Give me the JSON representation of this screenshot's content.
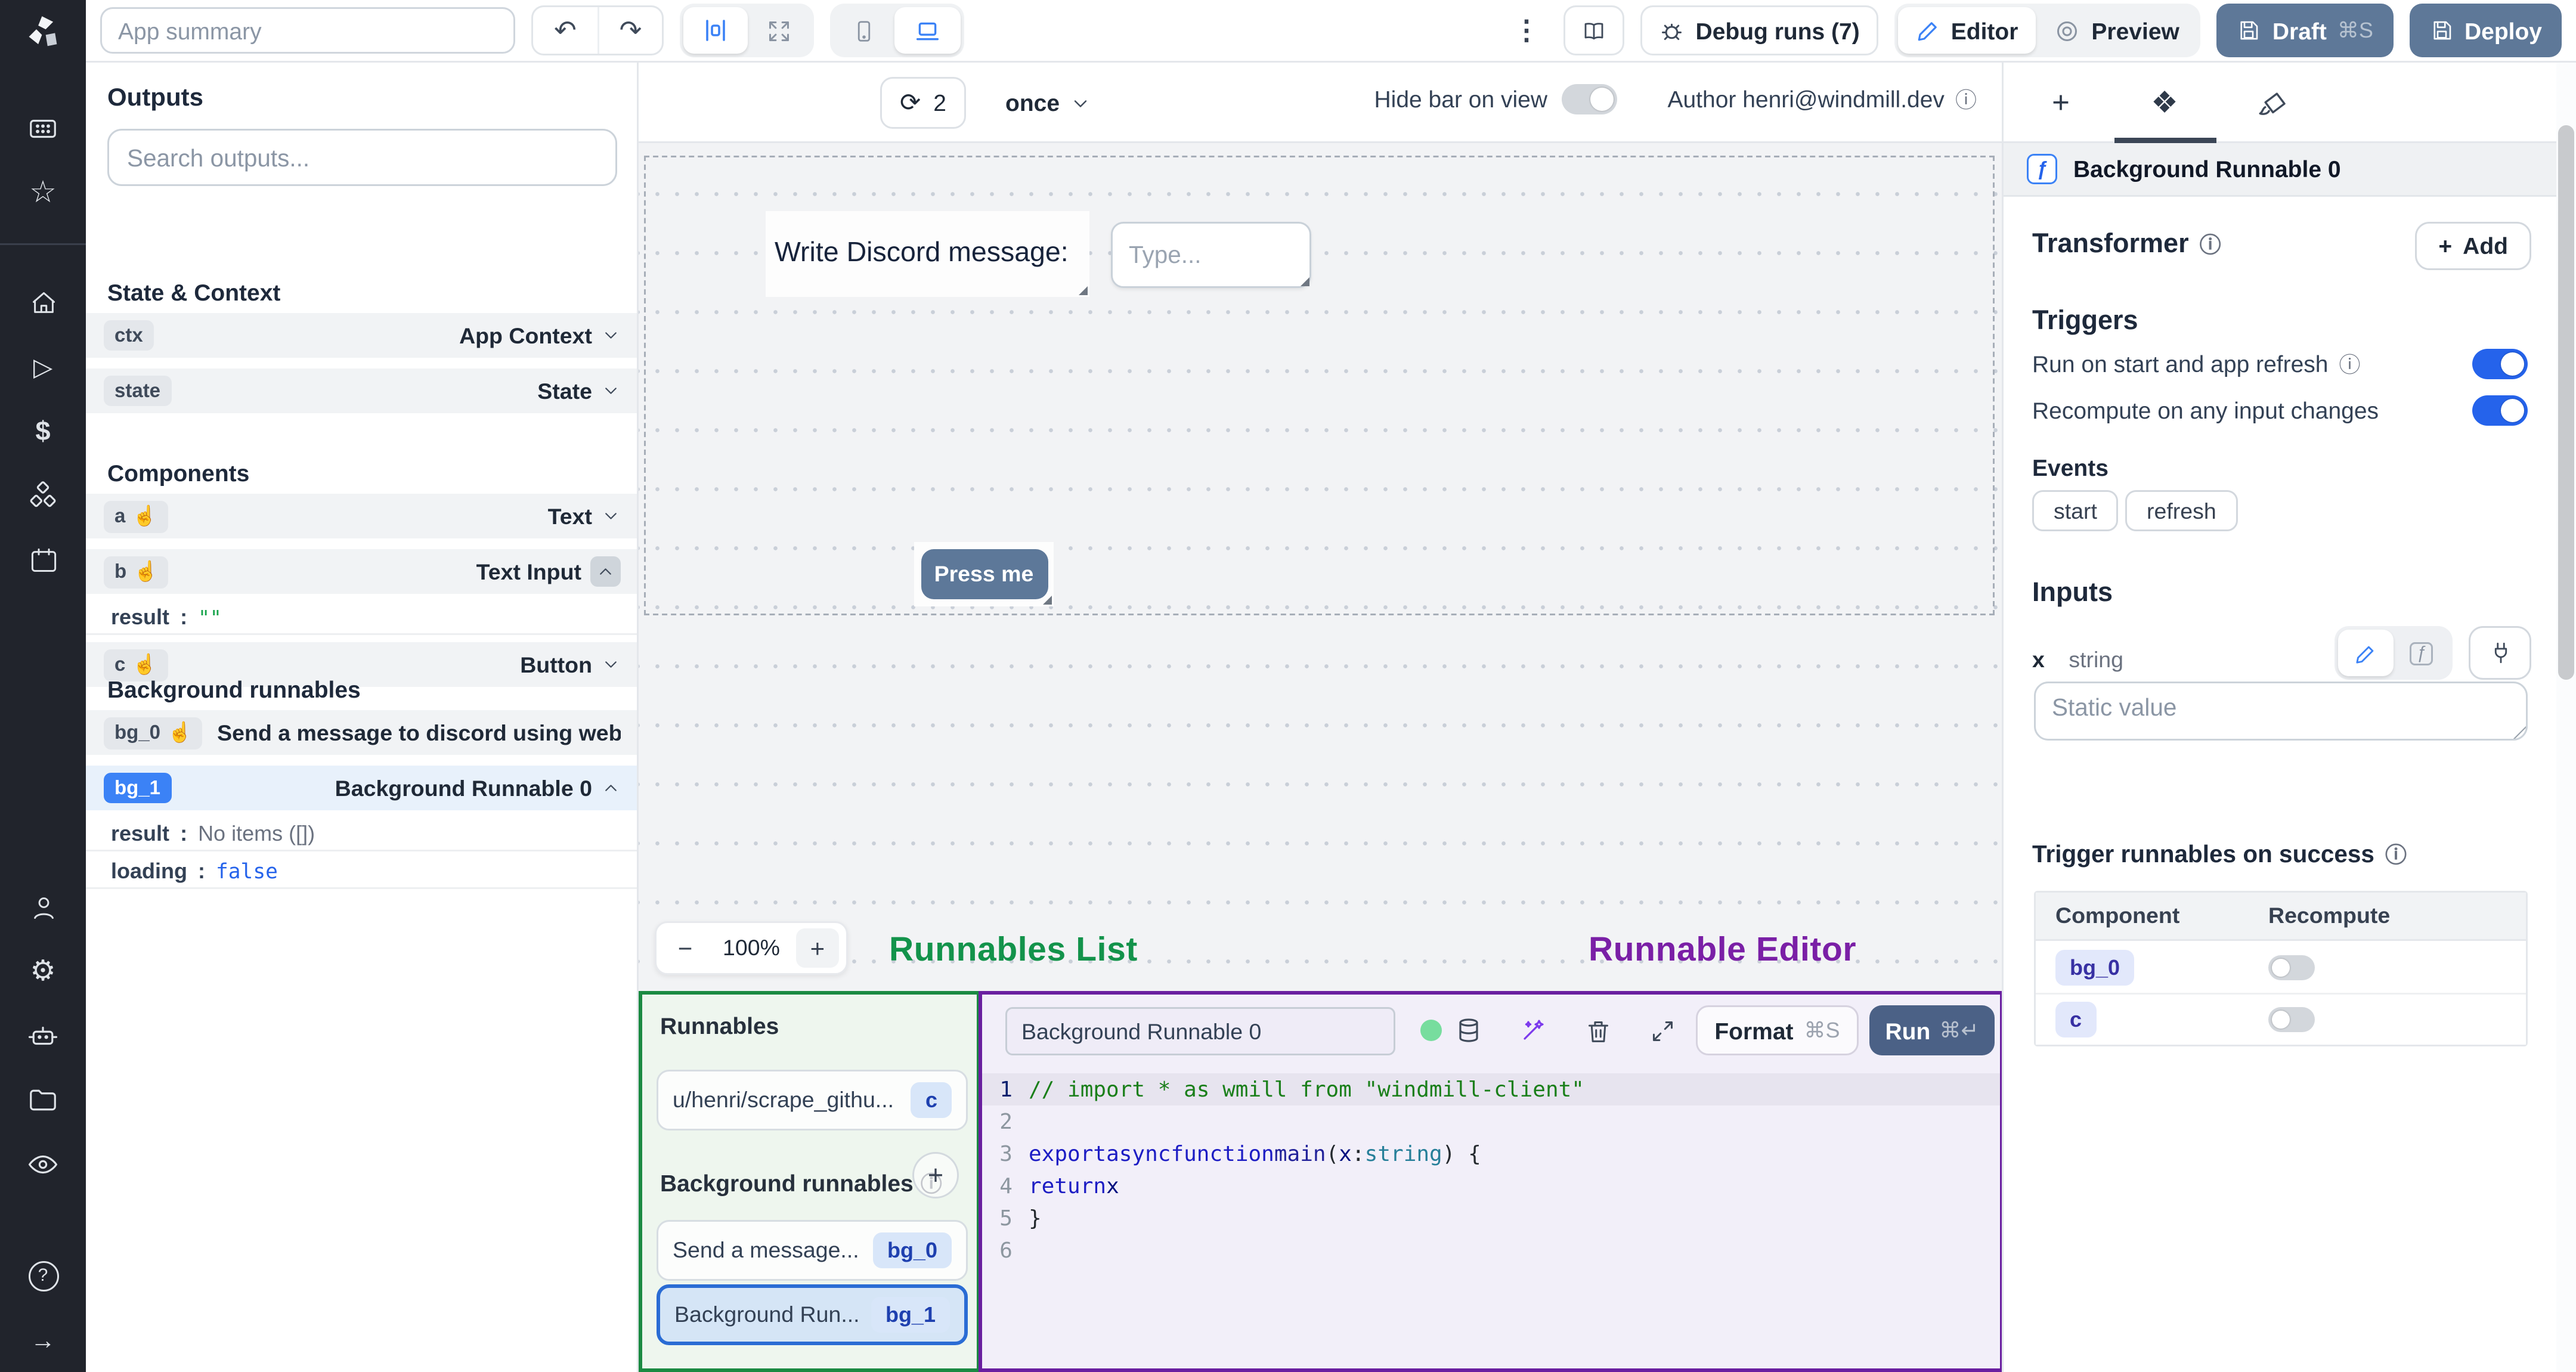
{
  "colors": {
    "accent": "#2563eb",
    "slate_button": "#5e7898",
    "annotation_green": "#13934b",
    "annotation_purple": "#7a1fa6",
    "badge_blue": "#3b82f6",
    "sidebar_bg": "#21242c"
  },
  "icons": {
    "kebab": "⋮",
    "undo": "↶",
    "redo": "↷",
    "refresh": "⟳",
    "command_s": "⌘S",
    "command_return": "⌘↵",
    "components_tab": "❖",
    "hand": "☝",
    "gear": "⚙",
    "star": "☆",
    "play": "▷",
    "dollar": "$",
    "arrow_right": "→",
    "info": "ⓘ",
    "plus": "+",
    "minus": "−",
    "fx": "ƒ",
    "help": "?"
  },
  "topbar": {
    "app_summary_placeholder": "App summary",
    "debug_runs_label": "Debug runs (7)",
    "editor_label": "Editor",
    "preview_label": "Preview",
    "draft_label": "Draft",
    "draft_shortcut": "⌘S",
    "deploy_label": "Deploy"
  },
  "outputs_panel": {
    "title": "Outputs",
    "search_placeholder": "Search outputs...",
    "state_context": {
      "title": "State & Context",
      "rows": [
        {
          "id": "ctx",
          "type": "App Context"
        },
        {
          "id": "state",
          "type": "State"
        }
      ]
    },
    "components": {
      "title": "Components",
      "rows": [
        {
          "id": "a",
          "type": "Text"
        },
        {
          "id": "b",
          "type": "Text Input"
        },
        {
          "id": "c",
          "type": "Button"
        }
      ],
      "b_result_key": "result",
      "b_result_value": "\"\""
    },
    "background_runnables": {
      "title": "Background runnables",
      "bg0": {
        "id": "bg_0",
        "label": "Send a message to discord using webhoo"
      },
      "bg1": {
        "id": "bg_1",
        "label": "Background Runnable 0"
      },
      "result_key": "result",
      "result_value": "No items ([])",
      "loading_key": "loading",
      "loading_value": "false"
    }
  },
  "canvas": {
    "toolbar": {
      "refresh_count": "2",
      "schedule": "once",
      "hide_bar_label": "Hide bar on view",
      "author_label": "Author henri@windmill.dev"
    },
    "components": {
      "text_label": "Write Discord message:",
      "input_placeholder": "Type...",
      "button_label": "Press me"
    },
    "zoom_level": "100%",
    "annotations": {
      "runnables_list": "Runnables List",
      "runnable_editor": "Runnable Editor"
    }
  },
  "runnables_panel": {
    "title": "Runnables",
    "inline_items": [
      {
        "label": "u/henri/scrape_githu...",
        "badge": "c"
      }
    ],
    "background_title": "Background runnables",
    "background_items": [
      {
        "label": "Send a message...",
        "badge": "bg_0"
      },
      {
        "label": "Background Run...",
        "badge": "bg_1"
      }
    ]
  },
  "editor_panel": {
    "name_value": "Background Runnable 0",
    "format_label": "Format",
    "format_shortcut": "⌘S",
    "run_label": "Run",
    "run_shortcut": "⌘↵",
    "code_lines": [
      [
        [
          "cmt",
          "// import * as wmill from \"windmill-client\""
        ]
      ],
      [],
      [
        [
          "kw",
          "export"
        ],
        [
          "pl",
          " "
        ],
        [
          "kw",
          "async"
        ],
        [
          "pl",
          " "
        ],
        [
          "kw",
          "function"
        ],
        [
          "pl",
          " "
        ],
        [
          "fn",
          "main"
        ],
        [
          "pl",
          "("
        ],
        [
          "vr",
          "x"
        ],
        [
          "pl",
          ": "
        ],
        [
          "ty",
          "string"
        ],
        [
          "pl",
          ") {"
        ]
      ],
      [
        [
          "pl",
          "  "
        ],
        [
          "kw",
          "return"
        ],
        [
          "pl",
          " "
        ],
        [
          "vr",
          "x"
        ]
      ],
      [
        [
          "pl",
          "}"
        ]
      ],
      []
    ]
  },
  "right_panel": {
    "header_title": "Background Runnable 0",
    "transformer_title": "Transformer",
    "add_label": "Add",
    "triggers_title": "Triggers",
    "trigger_rows": [
      {
        "label": "Run on start and app refresh"
      },
      {
        "label": "Recompute on any input changes"
      }
    ],
    "events_label": "Events",
    "events": [
      "start",
      "refresh"
    ],
    "inputs_title": "Inputs",
    "input_name": "x",
    "input_type": "string",
    "static_placeholder": "Static value",
    "success_title": "Trigger runnables on success",
    "table": {
      "columns": [
        "Component",
        "Recompute"
      ],
      "rows": [
        {
          "badge": "bg_0"
        },
        {
          "badge": "c"
        }
      ]
    }
  }
}
